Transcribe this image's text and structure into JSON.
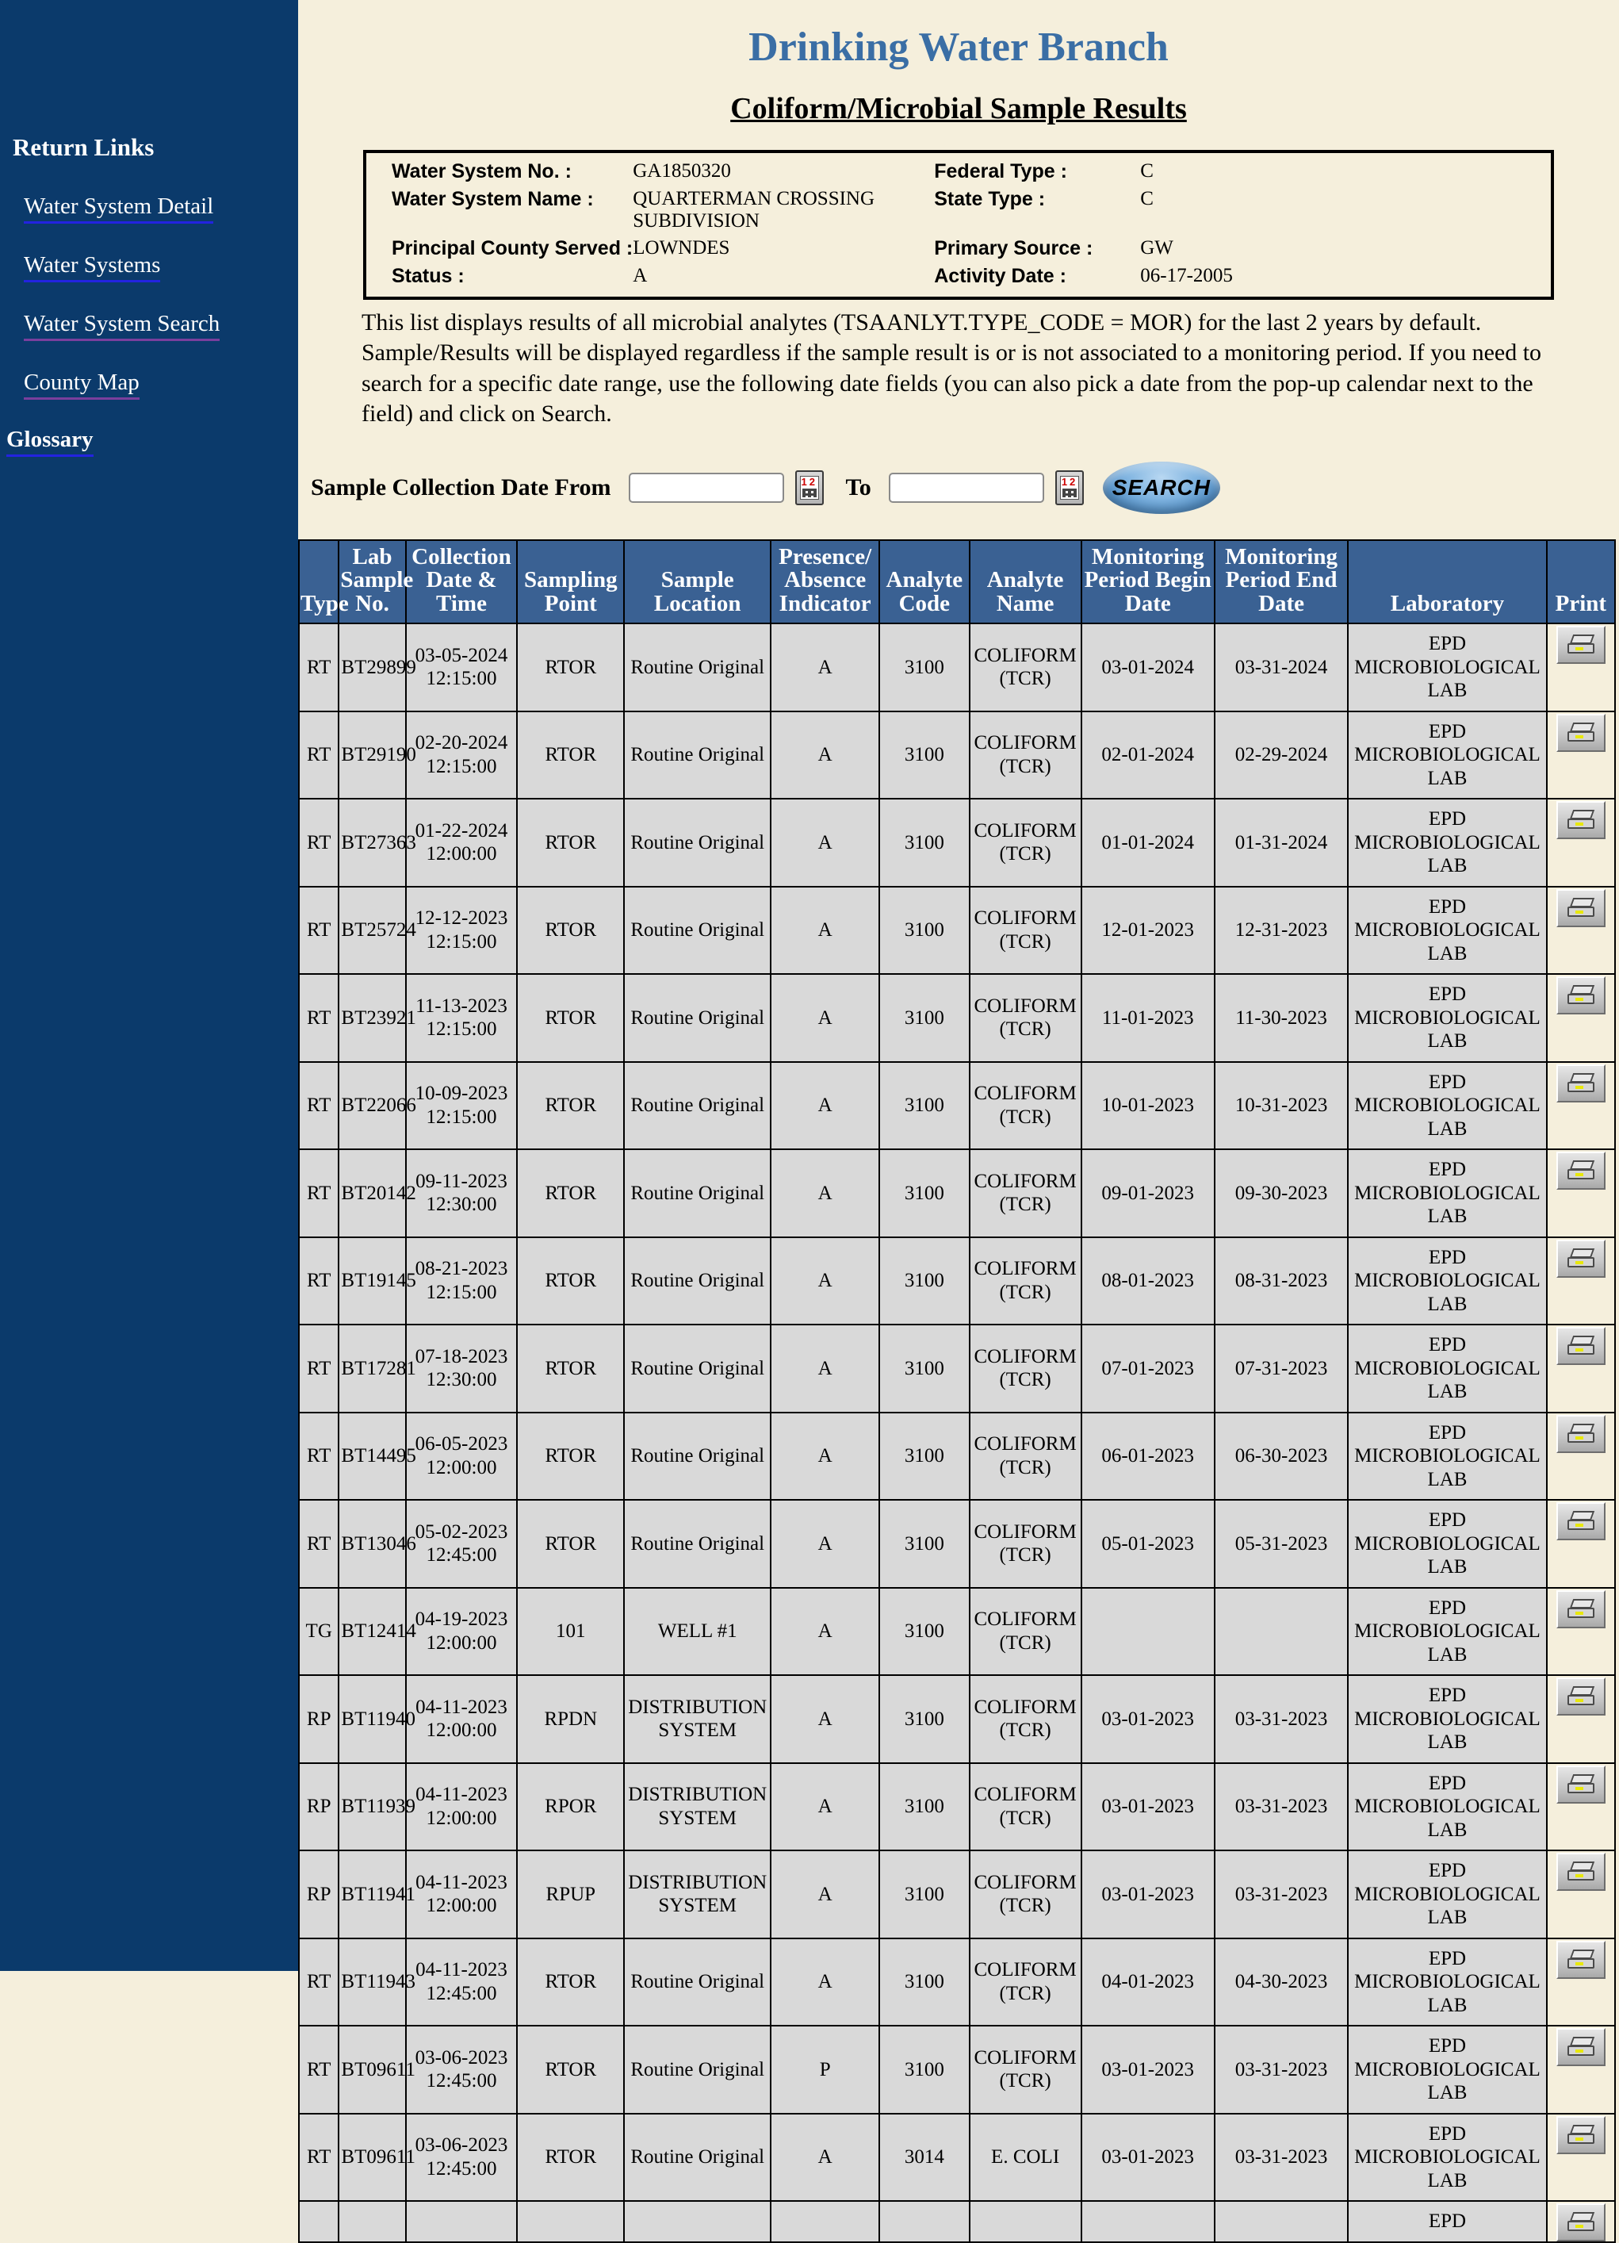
{
  "sidebar": {
    "heading": "Return Links",
    "links": [
      {
        "label": "Water System Detail",
        "state": "unvisited"
      },
      {
        "label": "Water Systems",
        "state": "unvisited"
      },
      {
        "label": "Water System Search",
        "state": "visited"
      },
      {
        "label": "County Map",
        "state": "visited"
      }
    ],
    "glossary": "Glossary",
    "background_color": "#0b3a6b"
  },
  "header": {
    "title": "Drinking Water Branch",
    "subtitle": "Coliform/Microbial Sample Results",
    "title_color": "#3a6ea5"
  },
  "info_box": {
    "water_system_no_label": "Water System No. :",
    "water_system_no_value": "GA1850320",
    "water_system_name_label": "Water System Name :",
    "water_system_name_value": "QUARTERMAN CROSSING SUBDIVISION",
    "principal_county_label": "Principal County Served :",
    "principal_county_value": "LOWNDES",
    "status_label": "Status :",
    "status_value": "A",
    "federal_type_label": "Federal Type :",
    "federal_type_value": "C",
    "state_type_label": "State Type :",
    "state_type_value": "C",
    "primary_source_label": "Primary Source :",
    "primary_source_value": "GW",
    "activity_date_label": "Activity Date :",
    "activity_date_value": "06-17-2005"
  },
  "description": "This list displays results of all microbial analytes (TSAANLYT.TYPE_CODE = MOR) for the last 2 years by default. Sample/Results will be displayed regardless if the sample result is or is not associated to a monitoring period. If you need to search for a specific date range, use the following date fields (you can also pick a date from the pop-up calendar next to the field) and click on Search.",
  "search": {
    "from_label": "Sample Collection Date From",
    "from_value": "",
    "from_placeholder": "",
    "to_label": "To",
    "to_value": "",
    "to_placeholder": "",
    "calendar_icon": "calendar-icon",
    "button_label": "SEARCH"
  },
  "table": {
    "columns": [
      "Type",
      "Lab Sample No.",
      "Collection Date & Time",
      "Sampling Point",
      "Sample Location",
      "Presence/ Absence Indicator",
      "Analyte Code",
      "Analyte Name",
      "Monitoring Period Begin Date",
      "Monitoring Period End Date",
      "Laboratory",
      "Print"
    ],
    "print_icon": "printer-icon",
    "rows": [
      {
        "type": "RT",
        "lab_sample_no": "BT29899",
        "collection_date": "03-05-2024",
        "collection_time": "12:15:00",
        "sampling_point": "RTOR",
        "sample_location": "Routine Original",
        "presence_absence": "A",
        "analyte_code": "3100",
        "analyte_name": "COLIFORM (TCR)",
        "mp_begin": "03-01-2024",
        "mp_end": "03-31-2024",
        "laboratory": "EPD MICROBIOLOGICAL LAB"
      },
      {
        "type": "RT",
        "lab_sample_no": "BT29190",
        "collection_date": "02-20-2024",
        "collection_time": "12:15:00",
        "sampling_point": "RTOR",
        "sample_location": "Routine Original",
        "presence_absence": "A",
        "analyte_code": "3100",
        "analyte_name": "COLIFORM (TCR)",
        "mp_begin": "02-01-2024",
        "mp_end": "02-29-2024",
        "laboratory": "EPD MICROBIOLOGICAL LAB"
      },
      {
        "type": "RT",
        "lab_sample_no": "BT27363",
        "collection_date": "01-22-2024",
        "collection_time": "12:00:00",
        "sampling_point": "RTOR",
        "sample_location": "Routine Original",
        "presence_absence": "A",
        "analyte_code": "3100",
        "analyte_name": "COLIFORM (TCR)",
        "mp_begin": "01-01-2024",
        "mp_end": "01-31-2024",
        "laboratory": "EPD MICROBIOLOGICAL LAB"
      },
      {
        "type": "RT",
        "lab_sample_no": "BT25724",
        "collection_date": "12-12-2023",
        "collection_time": "12:15:00",
        "sampling_point": "RTOR",
        "sample_location": "Routine Original",
        "presence_absence": "A",
        "analyte_code": "3100",
        "analyte_name": "COLIFORM (TCR)",
        "mp_begin": "12-01-2023",
        "mp_end": "12-31-2023",
        "laboratory": "EPD MICROBIOLOGICAL LAB"
      },
      {
        "type": "RT",
        "lab_sample_no": "BT23921",
        "collection_date": "11-13-2023",
        "collection_time": "12:15:00",
        "sampling_point": "RTOR",
        "sample_location": "Routine Original",
        "presence_absence": "A",
        "analyte_code": "3100",
        "analyte_name": "COLIFORM (TCR)",
        "mp_begin": "11-01-2023",
        "mp_end": "11-30-2023",
        "laboratory": "EPD MICROBIOLOGICAL LAB"
      },
      {
        "type": "RT",
        "lab_sample_no": "BT22066",
        "collection_date": "10-09-2023",
        "collection_time": "12:15:00",
        "sampling_point": "RTOR",
        "sample_location": "Routine Original",
        "presence_absence": "A",
        "analyte_code": "3100",
        "analyte_name": "COLIFORM (TCR)",
        "mp_begin": "10-01-2023",
        "mp_end": "10-31-2023",
        "laboratory": "EPD MICROBIOLOGICAL LAB"
      },
      {
        "type": "RT",
        "lab_sample_no": "BT20142",
        "collection_date": "09-11-2023",
        "collection_time": "12:30:00",
        "sampling_point": "RTOR",
        "sample_location": "Routine Original",
        "presence_absence": "A",
        "analyte_code": "3100",
        "analyte_name": "COLIFORM (TCR)",
        "mp_begin": "09-01-2023",
        "mp_end": "09-30-2023",
        "laboratory": "EPD MICROBIOLOGICAL LAB"
      },
      {
        "type": "RT",
        "lab_sample_no": "BT19145",
        "collection_date": "08-21-2023",
        "collection_time": "12:15:00",
        "sampling_point": "RTOR",
        "sample_location": "Routine Original",
        "presence_absence": "A",
        "analyte_code": "3100",
        "analyte_name": "COLIFORM (TCR)",
        "mp_begin": "08-01-2023",
        "mp_end": "08-31-2023",
        "laboratory": "EPD MICROBIOLOGICAL LAB"
      },
      {
        "type": "RT",
        "lab_sample_no": "BT17281",
        "collection_date": "07-18-2023",
        "collection_time": "12:30:00",
        "sampling_point": "RTOR",
        "sample_location": "Routine Original",
        "presence_absence": "A",
        "analyte_code": "3100",
        "analyte_name": "COLIFORM (TCR)",
        "mp_begin": "07-01-2023",
        "mp_end": "07-31-2023",
        "laboratory": "EPD MICROBIOLOGICAL LAB"
      },
      {
        "type": "RT",
        "lab_sample_no": "BT14495",
        "collection_date": "06-05-2023",
        "collection_time": "12:00:00",
        "sampling_point": "RTOR",
        "sample_location": "Routine Original",
        "presence_absence": "A",
        "analyte_code": "3100",
        "analyte_name": "COLIFORM (TCR)",
        "mp_begin": "06-01-2023",
        "mp_end": "06-30-2023",
        "laboratory": "EPD MICROBIOLOGICAL LAB"
      },
      {
        "type": "RT",
        "lab_sample_no": "BT13046",
        "collection_date": "05-02-2023",
        "collection_time": "12:45:00",
        "sampling_point": "RTOR",
        "sample_location": "Routine Original",
        "presence_absence": "A",
        "analyte_code": "3100",
        "analyte_name": "COLIFORM (TCR)",
        "mp_begin": "05-01-2023",
        "mp_end": "05-31-2023",
        "laboratory": "EPD MICROBIOLOGICAL LAB"
      },
      {
        "type": "TG",
        "lab_sample_no": "BT12414",
        "collection_date": "04-19-2023",
        "collection_time": "12:00:00",
        "sampling_point": "101",
        "sample_location": "WELL #1",
        "presence_absence": "A",
        "analyte_code": "3100",
        "analyte_name": "COLIFORM (TCR)",
        "mp_begin": "",
        "mp_end": "",
        "laboratory": "EPD MICROBIOLOGICAL LAB"
      },
      {
        "type": "RP",
        "lab_sample_no": "BT11940",
        "collection_date": "04-11-2023",
        "collection_time": "12:00:00",
        "sampling_point": "RPDN",
        "sample_location": "DISTRIBUTION SYSTEM",
        "presence_absence": "A",
        "analyte_code": "3100",
        "analyte_name": "COLIFORM (TCR)",
        "mp_begin": "03-01-2023",
        "mp_end": "03-31-2023",
        "laboratory": "EPD MICROBIOLOGICAL LAB"
      },
      {
        "type": "RP",
        "lab_sample_no": "BT11939",
        "collection_date": "04-11-2023",
        "collection_time": "12:00:00",
        "sampling_point": "RPOR",
        "sample_location": "DISTRIBUTION SYSTEM",
        "presence_absence": "A",
        "analyte_code": "3100",
        "analyte_name": "COLIFORM (TCR)",
        "mp_begin": "03-01-2023",
        "mp_end": "03-31-2023",
        "laboratory": "EPD MICROBIOLOGICAL LAB"
      },
      {
        "type": "RP",
        "lab_sample_no": "BT11941",
        "collection_date": "04-11-2023",
        "collection_time": "12:00:00",
        "sampling_point": "RPUP",
        "sample_location": "DISTRIBUTION SYSTEM",
        "presence_absence": "A",
        "analyte_code": "3100",
        "analyte_name": "COLIFORM (TCR)",
        "mp_begin": "03-01-2023",
        "mp_end": "03-31-2023",
        "laboratory": "EPD MICROBIOLOGICAL LAB"
      },
      {
        "type": "RT",
        "lab_sample_no": "BT11943",
        "collection_date": "04-11-2023",
        "collection_time": "12:45:00",
        "sampling_point": "RTOR",
        "sample_location": "Routine Original",
        "presence_absence": "A",
        "analyte_code": "3100",
        "analyte_name": "COLIFORM (TCR)",
        "mp_begin": "04-01-2023",
        "mp_end": "04-30-2023",
        "laboratory": "EPD MICROBIOLOGICAL LAB"
      },
      {
        "type": "RT",
        "lab_sample_no": "BT09611",
        "collection_date": "03-06-2023",
        "collection_time": "12:45:00",
        "sampling_point": "RTOR",
        "sample_location": "Routine Original",
        "presence_absence": "P",
        "analyte_code": "3100",
        "analyte_name": "COLIFORM (TCR)",
        "mp_begin": "03-01-2023",
        "mp_end": "03-31-2023",
        "laboratory": "EPD MICROBIOLOGICAL LAB"
      },
      {
        "type": "RT",
        "lab_sample_no": "BT09611",
        "collection_date": "03-06-2023",
        "collection_time": "12:45:00",
        "sampling_point": "RTOR",
        "sample_location": "Routine Original",
        "presence_absence": "A",
        "analyte_code": "3014",
        "analyte_name": "E. COLI",
        "mp_begin": "03-01-2023",
        "mp_end": "03-31-2023",
        "laboratory": "EPD MICROBIOLOGICAL LAB"
      },
      {
        "type": "",
        "lab_sample_no": "",
        "collection_date": "",
        "collection_time": "",
        "sampling_point": "",
        "sample_location": "",
        "presence_absence": "",
        "analyte_code": "",
        "analyte_name": "",
        "mp_begin": "",
        "mp_end": "",
        "laboratory": "EPD"
      }
    ]
  }
}
